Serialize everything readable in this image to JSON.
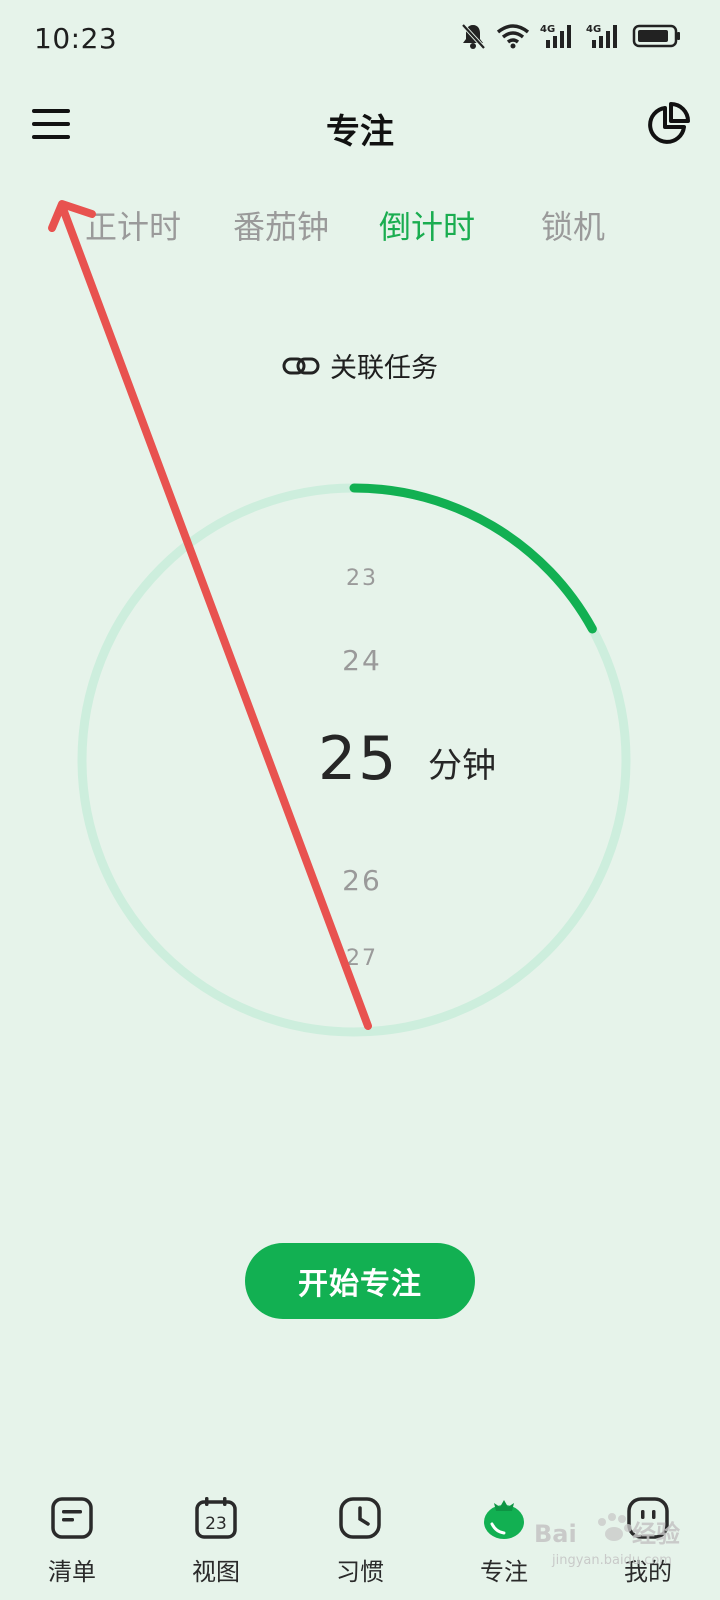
{
  "status_bar": {
    "time": "10:23"
  },
  "header": {
    "title": "专注"
  },
  "mode_tabs": [
    {
      "label": "正计时",
      "active": false
    },
    {
      "label": "番茄钟",
      "active": false
    },
    {
      "label": "倒计时",
      "active": true
    },
    {
      "label": "锁机",
      "active": false
    }
  ],
  "link_task": {
    "label": "关联任务"
  },
  "picker": {
    "above_2": "23",
    "above_1": "24",
    "current": "25",
    "unit": "分钟",
    "below_1": "26",
    "below_2": "27"
  },
  "progress_fraction": 0.17,
  "start_button": {
    "label": "开始专注"
  },
  "bottom_nav": [
    {
      "label": "清单",
      "icon": "list-icon"
    },
    {
      "label": "视图",
      "icon": "calendar-icon",
      "badge": "23"
    },
    {
      "label": "习惯",
      "icon": "clock-icon"
    },
    {
      "label": "专注",
      "icon": "tomato-icon",
      "active": true
    },
    {
      "label": "我的",
      "icon": "profile-icon"
    }
  ],
  "colors": {
    "background": "#e6f3ea",
    "accent": "#1aad50",
    "ring_track": "#cdeedd",
    "annotation_arrow": "#e8524f"
  }
}
